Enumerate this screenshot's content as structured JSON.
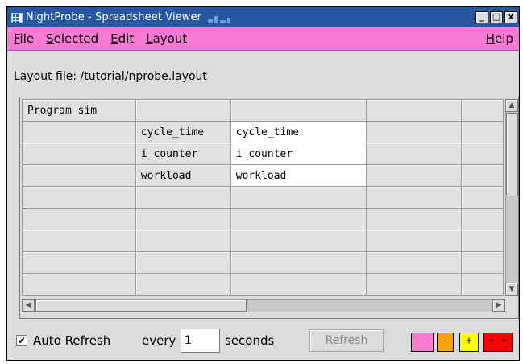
{
  "window": {
    "title": "NightProbe - Spreadsheet Viewer",
    "minimize_glyph": "_",
    "maximize_glyph": "□",
    "close_glyph": "x"
  },
  "menu": {
    "file": {
      "key": "F",
      "rest": "ile"
    },
    "selected": {
      "key": "S",
      "rest": "elected"
    },
    "edit": {
      "key": "E",
      "rest": "dit"
    },
    "layout": {
      "key": "L",
      "rest": "ayout"
    },
    "help": {
      "key": "H",
      "rest": "elp"
    }
  },
  "layout_file_label": "Layout file: /tutorial/nprobe.layout",
  "grid": {
    "rows": [
      [
        "Program sim",
        "",
        "",
        "",
        ""
      ],
      [
        "",
        "cycle_time",
        "cycle_time",
        "",
        ""
      ],
      [
        "",
        "i_counter",
        "i_counter",
        "",
        ""
      ],
      [
        "",
        "workload",
        "workload",
        "",
        ""
      ],
      [
        "",
        "",
        "",
        "",
        ""
      ],
      [
        "",
        "",
        "",
        "",
        ""
      ],
      [
        "",
        "",
        "",
        "",
        ""
      ],
      [
        "",
        "",
        "",
        "",
        ""
      ],
      [
        "",
        "",
        "",
        "",
        ""
      ]
    ]
  },
  "bottom": {
    "auto_refresh_label": "Auto Refresh",
    "auto_refresh_checked": "✔",
    "every_label": "every",
    "seconds_value": "1",
    "seconds_label": "seconds",
    "refresh_label": "Refresh",
    "speed_buttons": [
      {
        "label": "- -",
        "color": "#f87ad2"
      },
      {
        "label": "-",
        "color": "#ffa200"
      },
      {
        "label": "+",
        "color": "#ffff00"
      },
      {
        "label": "+ +",
        "color": "#ff0000"
      }
    ]
  },
  "colors": {
    "titlebar": "#27589f",
    "menubar": "#f87ad2",
    "window_bg": "#dcdcdc"
  }
}
